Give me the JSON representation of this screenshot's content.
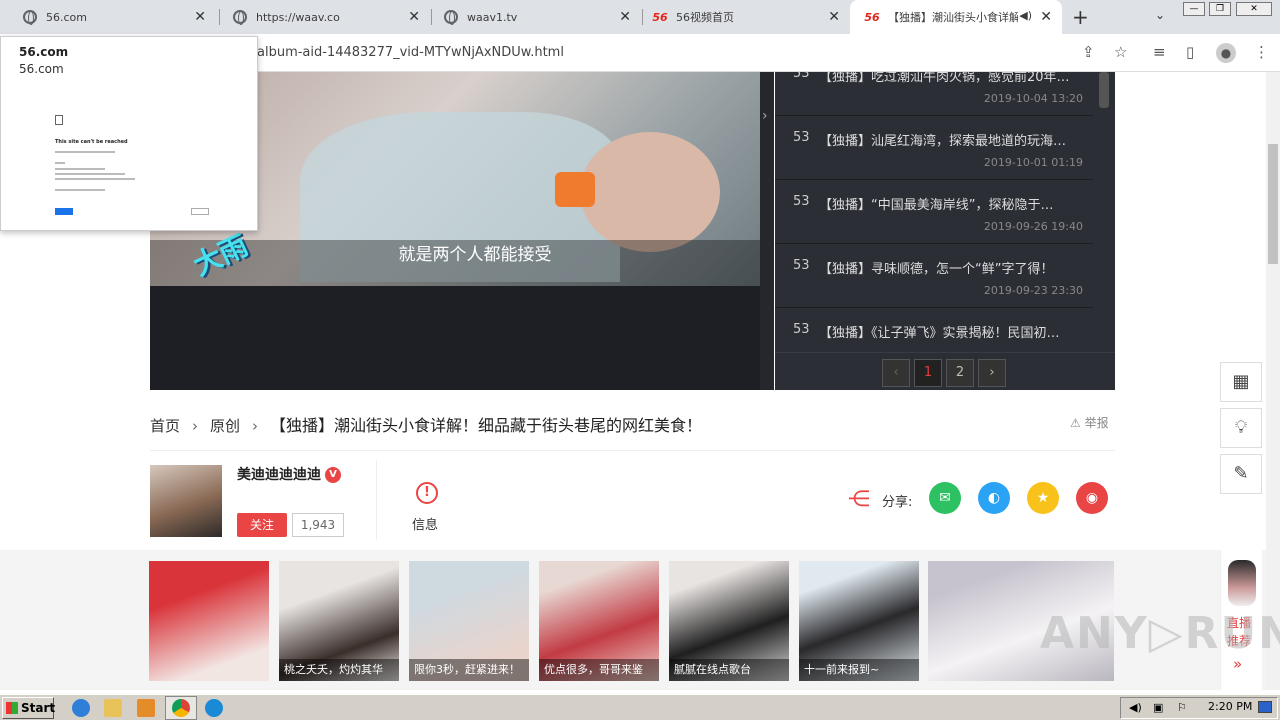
{
  "browser": {
    "tabs": [
      {
        "title": "56.com",
        "icon": "globe-icon"
      },
      {
        "title": "https://waav.co",
        "icon": "globe-icon"
      },
      {
        "title": "waav1.tv",
        "icon": "globe-icon"
      },
      {
        "title": "56视频首页",
        "icon": "56-logo-icon"
      },
      {
        "title": "【独播】潮汕街头小食详解",
        "icon": "56-logo-icon",
        "active": true
      }
    ],
    "logo56": "56",
    "url": "album-aid-14483277_vid-MTYwNjAxNDUw.html"
  },
  "popup": {
    "title": "56.com",
    "subtitle": "56.com",
    "preview_heading": "This site can't be reached"
  },
  "player": {
    "subtitle": "就是两个人都能接受",
    "overlay_text": "大雨"
  },
  "playlist": {
    "items": [
      {
        "num": "53",
        "title": "【独播】吃过潮汕牛肉火锅，感觉前20年…",
        "date": "2019-10-04 13:20"
      },
      {
        "num": "53",
        "title": "【独播】汕尾红海湾，探索最地道的玩海…",
        "date": "2019-10-01 01:19"
      },
      {
        "num": "53",
        "title": "【独播】“中国最美海岸线”，探秘隐于…",
        "date": "2019-09-26 19:40"
      },
      {
        "num": "53",
        "title": "【独播】寻味顺德，怎一个“鲜”字了得！",
        "date": "2019-09-23 23:30"
      },
      {
        "num": "53",
        "title": "【独播】《让子弹飞》实景揭秘！民国初…",
        "date": ""
      }
    ],
    "pages": [
      "1",
      "2"
    ],
    "current_page": "1"
  },
  "breadcrumb": {
    "home": "首页",
    "category": "原创",
    "title": "【独播】潮汕街头小食详解！细品藏于街头巷尾的网红美食！"
  },
  "report_label": "举报",
  "uploader": {
    "name": "美迪迪迪迪迪",
    "verified_badge": "V",
    "follow_label": "关注",
    "follower_count": "1,943"
  },
  "info_label": "信息",
  "share": {
    "label": "分享:",
    "targets": [
      {
        "name": "wechat",
        "color": "#2dc163",
        "glyph": "✉"
      },
      {
        "name": "qq",
        "color": "#2aa3f5",
        "glyph": "◐"
      },
      {
        "name": "qzone",
        "color": "#f8c21b",
        "glyph": "★"
      },
      {
        "name": "weibo",
        "color": "#e94545",
        "glyph": "◉"
      }
    ]
  },
  "recommend": [
    {
      "caption": "",
      "colors": [
        "#d9343a",
        "#f2e6e3"
      ]
    },
    {
      "caption": "桃之夭夭，灼灼其华",
      "colors": [
        "#e8e4e2",
        "#3a2e2a"
      ]
    },
    {
      "caption": "限你3秒，赶紧进来！",
      "colors": [
        "#cfd9e0",
        "#e9d4cc"
      ]
    },
    {
      "caption": "优点很多，哥哥来鉴",
      "colors": [
        "#c23b44",
        "#f0d2cc"
      ]
    },
    {
      "caption": "腻腻在线点歌台",
      "colors": [
        "#1f1f1f",
        "#e8e4e2"
      ]
    },
    {
      "caption": "十一前来报到~",
      "colors": [
        "#dfe9ef",
        "#29282b"
      ]
    },
    {
      "caption": "",
      "colors": [
        "#c7c3ce",
        "#f4f2f4"
      ]
    }
  ],
  "live": {
    "label": "直播推荐",
    "arrow": "»"
  },
  "side_tools": [
    "qr-code-icon",
    "lightbulb-icon",
    "edit-icon"
  ],
  "taskbar": {
    "start": "Start",
    "time": "2:20 PM"
  }
}
